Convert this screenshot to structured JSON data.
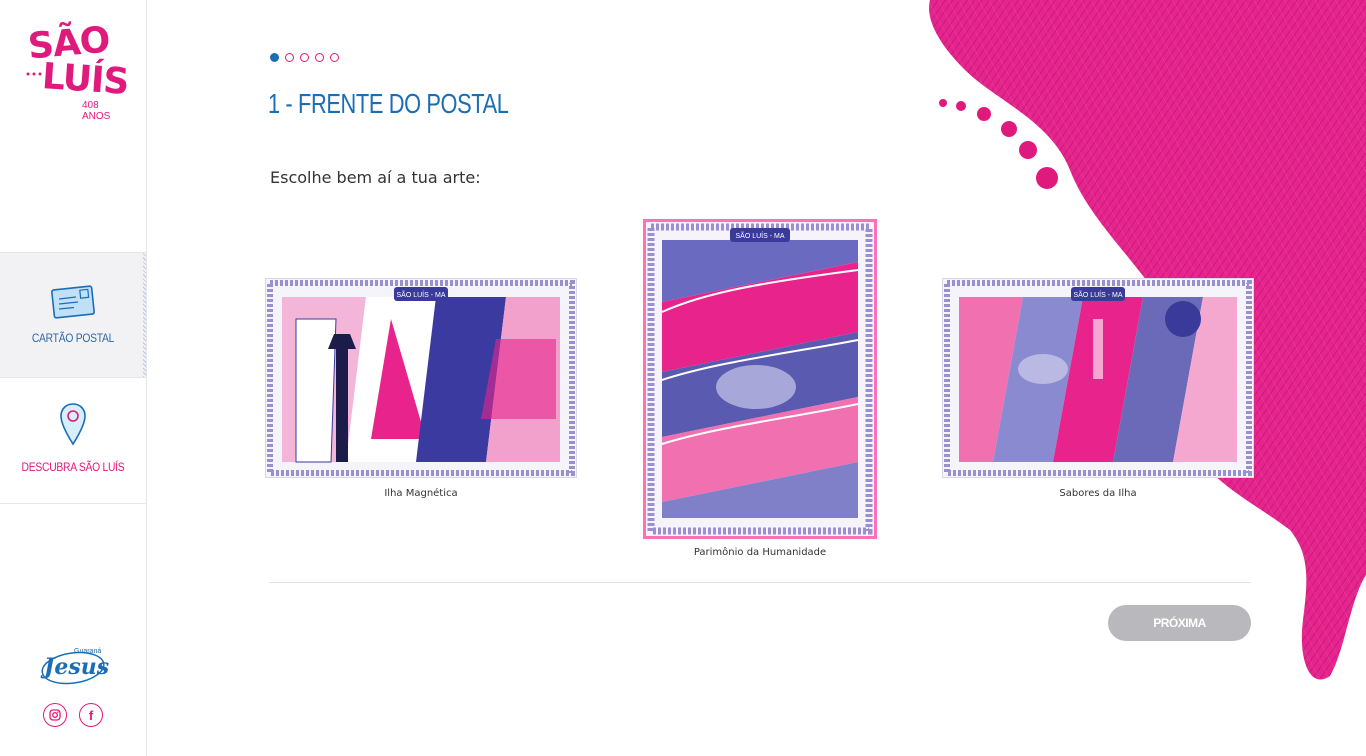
{
  "sidebar": {
    "logo": {
      "line1": "SÃO",
      "line2": "LUÍS",
      "subtitle": "408 ANOS"
    },
    "items": [
      {
        "label": "CARTÃO POSTAL",
        "icon": "postcard-icon",
        "active": true
      },
      {
        "label": "DESCUBRA SÃO LUÍS",
        "icon": "map-pin-icon",
        "active": false
      }
    ],
    "brand": {
      "name": "Jesus",
      "small": "Guaraná"
    },
    "social": [
      {
        "icon": "instagram-icon"
      },
      {
        "icon": "facebook-icon",
        "glyph": "f"
      }
    ]
  },
  "main": {
    "progress": {
      "total": 5,
      "current": 1
    },
    "title": "1 - FRENTE DO POSTAL",
    "instruction": "Escolhe bem aí a tua arte:",
    "cards": [
      {
        "caption": "Ilha Magnética",
        "banner": "SÃO LUÍS - MA",
        "selected": false
      },
      {
        "caption": "Parimônio da Humanidade",
        "banner": "SÃO LUÍS - MA",
        "selected": true
      },
      {
        "caption": "Sabores da Ilha",
        "banner": "SÃO LUÍS - MA",
        "selected": false
      }
    ],
    "next_label": "PRÓXIMA"
  },
  "colors": {
    "brand_pink": "#e0197d",
    "brand_blue": "#1b6db6",
    "art_purple": "#5a5aa8",
    "art_pink": "#e8248c",
    "button_disabled": "#b9b9bd"
  }
}
